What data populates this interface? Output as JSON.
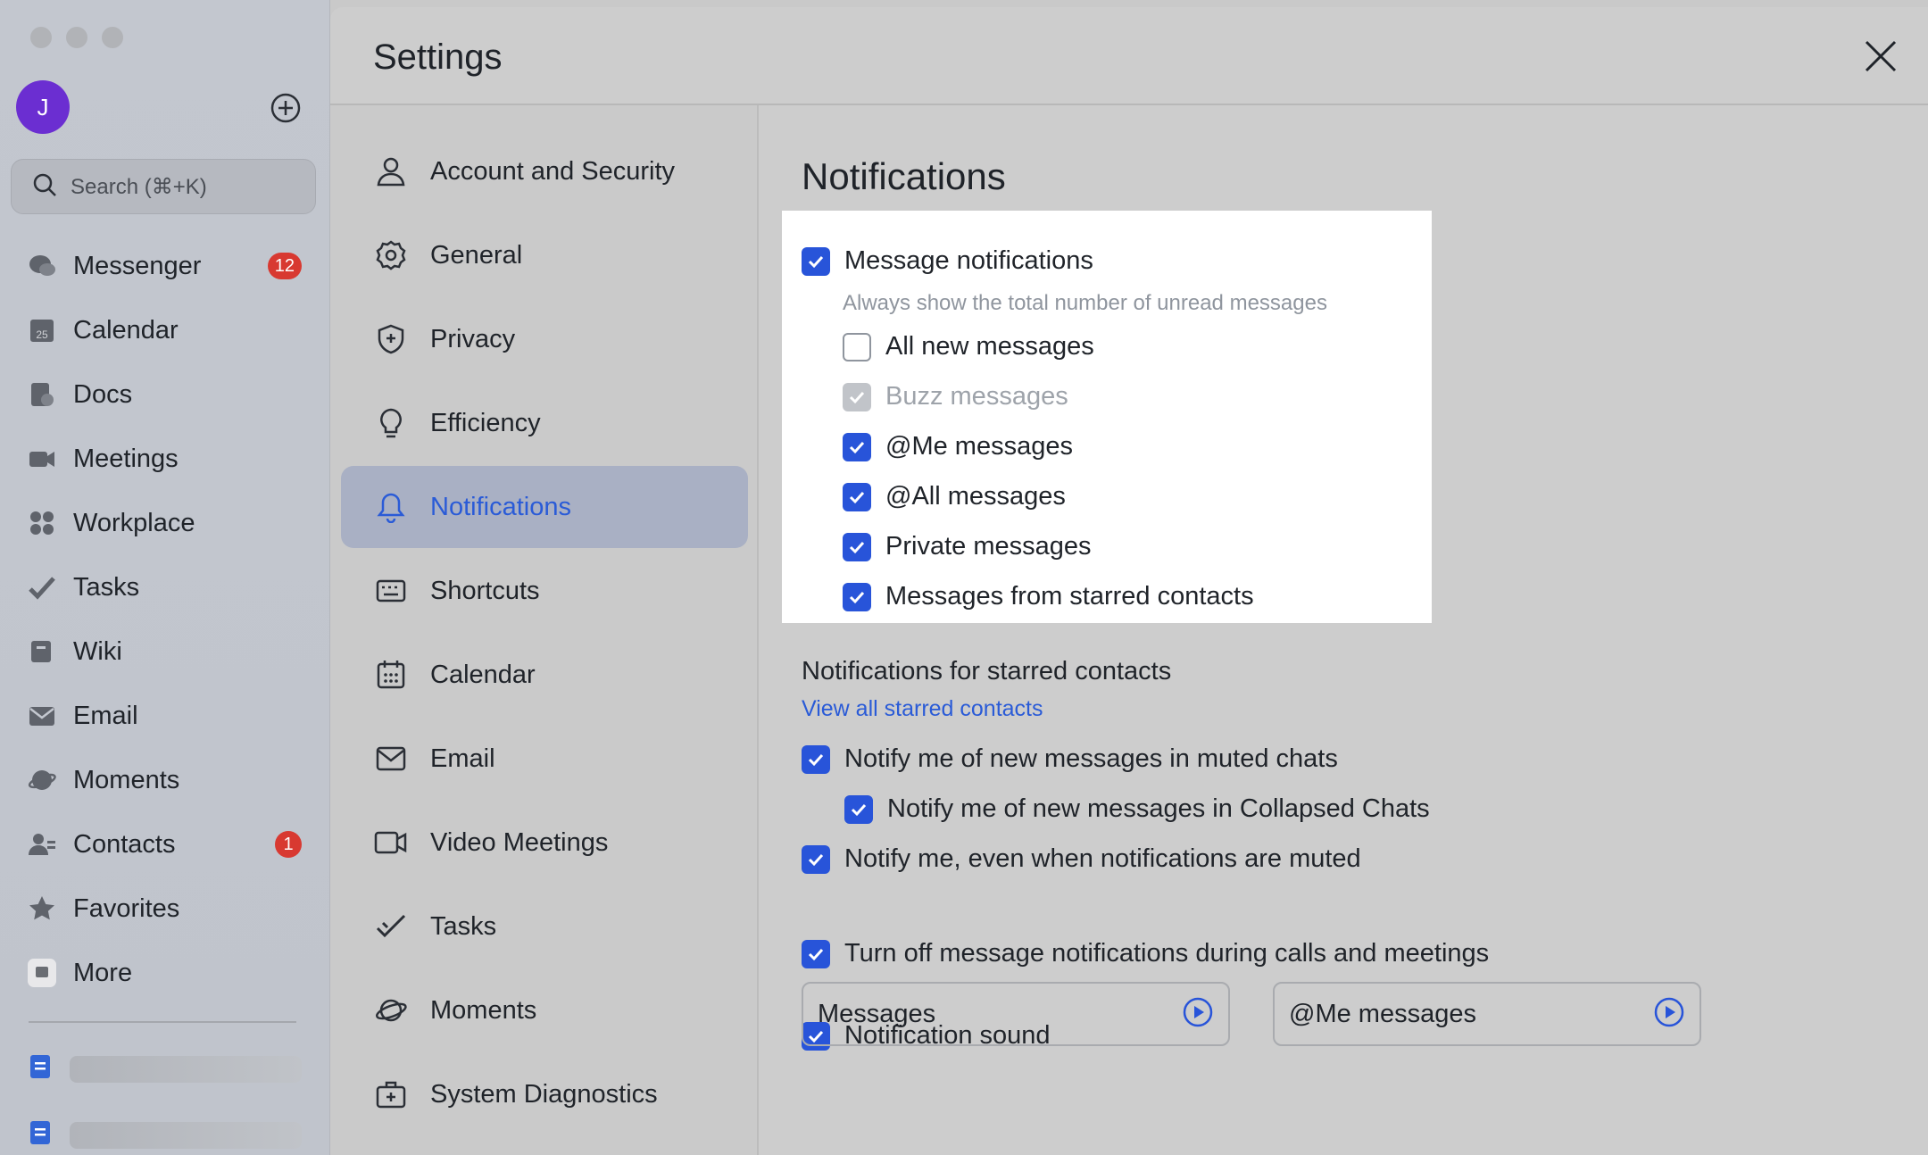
{
  "sidebar": {
    "avatar_initial": "J",
    "search_placeholder": "Search (⌘+K)",
    "items": [
      {
        "label": "Messenger",
        "icon": "messenger-icon",
        "badge": "12"
      },
      {
        "label": "Calendar",
        "icon": "calendar-icon",
        "badge": null
      },
      {
        "label": "Docs",
        "icon": "docs-icon",
        "badge": null
      },
      {
        "label": "Meetings",
        "icon": "meetings-icon",
        "badge": null
      },
      {
        "label": "Workplace",
        "icon": "workplace-icon",
        "badge": null
      },
      {
        "label": "Tasks",
        "icon": "tasks-icon",
        "badge": null
      },
      {
        "label": "Wiki",
        "icon": "wiki-icon",
        "badge": null
      },
      {
        "label": "Email",
        "icon": "email-icon",
        "badge": null
      },
      {
        "label": "Moments",
        "icon": "moments-icon",
        "badge": null
      },
      {
        "label": "Contacts",
        "icon": "contacts-icon",
        "badge": "1"
      },
      {
        "label": "Favorites",
        "icon": "favorites-icon",
        "badge": null
      },
      {
        "label": "More",
        "icon": "more-icon",
        "badge": null
      }
    ],
    "calendar_icon_day": "25"
  },
  "settings": {
    "title": "Settings",
    "menu": [
      {
        "label": "Account and Security",
        "icon": "user-icon"
      },
      {
        "label": "General",
        "icon": "gear-icon"
      },
      {
        "label": "Privacy",
        "icon": "shield-icon"
      },
      {
        "label": "Efficiency",
        "icon": "lightbulb-icon"
      },
      {
        "label": "Notifications",
        "icon": "bell-icon",
        "active": true
      },
      {
        "label": "Shortcuts",
        "icon": "keyboard-icon"
      },
      {
        "label": "Calendar",
        "icon": "calendar-icon"
      },
      {
        "label": "Email",
        "icon": "envelope-icon"
      },
      {
        "label": "Video Meetings",
        "icon": "video-icon"
      },
      {
        "label": "Tasks",
        "icon": "task-check-icon"
      },
      {
        "label": "Moments",
        "icon": "planet-icon"
      },
      {
        "label": "System Diagnostics",
        "icon": "toolbox-icon"
      }
    ]
  },
  "notifications": {
    "title": "Notifications",
    "message_notifications": {
      "label": "Message notifications",
      "checked": true
    },
    "unread_hint": "Always show the total number of unread messages",
    "options": [
      {
        "label": "All new messages",
        "state": "off"
      },
      {
        "label": "Buzz messages",
        "state": "disabled"
      },
      {
        "label": "@Me messages",
        "state": "on"
      },
      {
        "label": "@All messages",
        "state": "on"
      },
      {
        "label": "Private messages",
        "state": "on"
      },
      {
        "label": "Messages from starred contacts",
        "state": "on"
      }
    ],
    "starred_title": "Notifications for starred contacts",
    "starred_link": "View all starred contacts",
    "muted_options": [
      {
        "label": "Notify me of new messages in muted chats",
        "checked": true
      },
      {
        "label": "Notify me of new messages in Collapsed Chats",
        "checked": true
      },
      {
        "label": "Notify me, even when notifications are muted",
        "checked": true
      }
    ],
    "calls_option": {
      "label": "Turn off message notifications during calls and meetings",
      "checked": true
    },
    "sound_option": {
      "label": "Notification sound",
      "checked": true
    },
    "sound_boxes": [
      {
        "label": "Messages"
      },
      {
        "label": "@Me messages"
      }
    ]
  },
  "colors": {
    "accent": "#2854d9",
    "badge": "#d83931",
    "avatar": "#6b2ed1"
  }
}
